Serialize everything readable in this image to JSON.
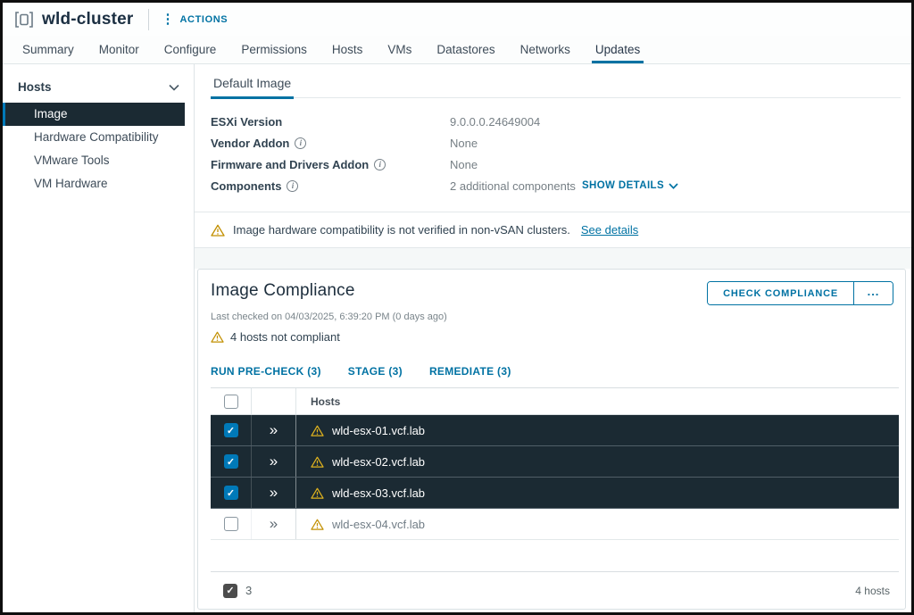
{
  "header": {
    "title": "wld-cluster",
    "actions_label": "ACTIONS"
  },
  "tabs": [
    "Summary",
    "Monitor",
    "Configure",
    "Permissions",
    "Hosts",
    "VMs",
    "Datastores",
    "Networks",
    "Updates"
  ],
  "active_tab": "Updates",
  "sidebar": {
    "group_label": "Hosts",
    "items": [
      "Image",
      "Hardware Compatibility",
      "VMware Tools",
      "VM Hardware"
    ],
    "selected_item": "Image"
  },
  "default_image": {
    "tab_label": "Default Image",
    "fields": [
      {
        "label": "ESXi Version",
        "value": "9.0.0.0.24649004"
      },
      {
        "label": "Vendor Addon",
        "value": "None"
      },
      {
        "label": "Firmware and Drivers Addon",
        "value": "None"
      },
      {
        "label": "Components",
        "value": "2 additional components",
        "link": "SHOW DETAILS"
      }
    ]
  },
  "warning_banner": {
    "text": "Image hardware compatibility is not verified in non-vSAN clusters.",
    "link": "See details"
  },
  "compliance": {
    "title": "Image Compliance",
    "last_checked": "Last checked on 04/03/2025, 6:39:20 PM (0 days ago)",
    "status": "4 hosts not compliant",
    "buttons": {
      "check": "CHECK COMPLIANCE",
      "more": "..."
    },
    "links": [
      "RUN PRE-CHECK (3)",
      "STAGE (3)",
      "REMEDIATE (3)"
    ],
    "table": {
      "column_header": "Hosts",
      "rows": [
        {
          "host": "wld-esx-01.vcf.lab",
          "checked": true
        },
        {
          "host": "wld-esx-02.vcf.lab",
          "checked": true
        },
        {
          "host": "wld-esx-03.vcf.lab",
          "checked": true
        },
        {
          "host": "wld-esx-04.vcf.lab",
          "checked": false
        }
      ],
      "footer": {
        "selected_count": "3",
        "total_label": "4 hosts"
      }
    }
  },
  "icons": {
    "check": "✓",
    "expand": "»",
    "kebab": "⋮",
    "info": "i"
  },
  "colors": {
    "accent_blue": "#0072a3",
    "checkbox_blue": "#0079b8",
    "dark_row": "#1b2a33",
    "warning_gold": "#c28f00"
  }
}
